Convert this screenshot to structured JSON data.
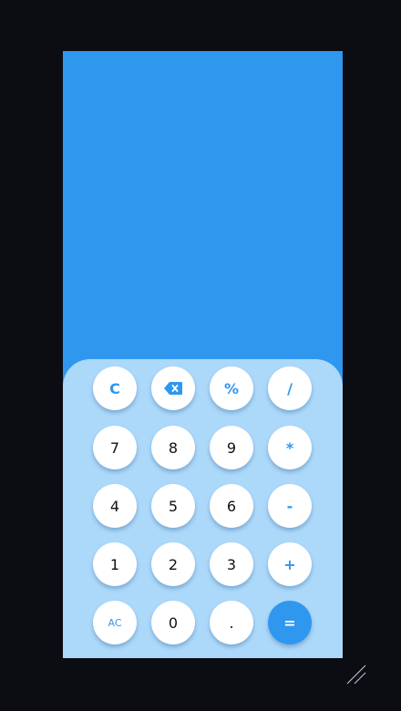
{
  "display": {
    "value": ""
  },
  "keys": {
    "clear": "C",
    "backspace_icon": "backspace-icon",
    "percent": "%",
    "divide": "/",
    "seven": "7",
    "eight": "8",
    "nine": "9",
    "multiply": "*",
    "four": "4",
    "five": "5",
    "six": "6",
    "subtract": "-",
    "one": "1",
    "two": "2",
    "three": "3",
    "add": "+",
    "all_clear": "AC",
    "zero": "0",
    "decimal": ".",
    "equals": "="
  },
  "colors": {
    "accent": "#2f97ee",
    "keypad_background": "#acd8fa",
    "key_background": "#ffffff",
    "frame_background": "#0b0d13"
  }
}
